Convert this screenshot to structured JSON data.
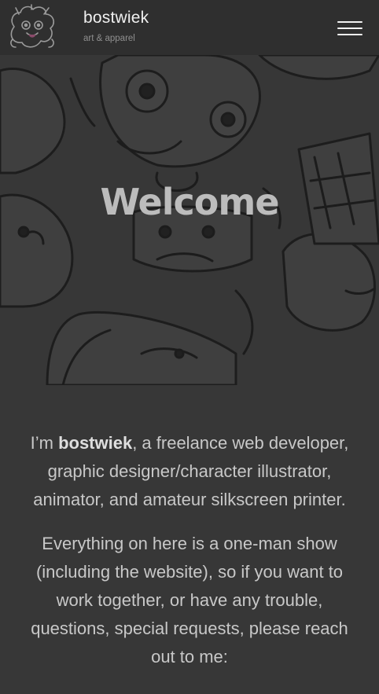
{
  "header": {
    "site_title": "bostwiek",
    "tagline": "art & apparel"
  },
  "hero": {
    "title": "Welcome"
  },
  "intro": {
    "p1_prefix": "I’m ",
    "p1_name": "bostwiek",
    "p1_rest": ", a freelance web developer, graphic designer/character illustrator, animator, and amateur silkscreen printer.",
    "p2": "Everything on here is a one-man show (including the website), so if you want to work together, or have any trouble, questions, special requests, please reach out to me:"
  },
  "colors": {
    "header_bg": "#2f2f2f",
    "page_bg": "#373737",
    "text": "#c8c8c8"
  }
}
